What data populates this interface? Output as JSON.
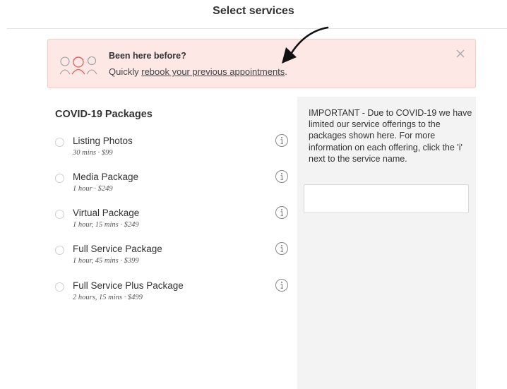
{
  "header": {
    "title": "Select services"
  },
  "banner": {
    "title": "Been here before?",
    "text_prefix": "Quickly ",
    "link_text": "rebook your previous appointments",
    "text_suffix": ".",
    "accent_color": "#e0605a",
    "background_color": "#fde8e6"
  },
  "services_section": {
    "title": "COVID-19 Packages",
    "items": [
      {
        "name": "Listing Photos",
        "meta": "30 mins · $99"
      },
      {
        "name": "Media Package",
        "meta": "1 hour · $249"
      },
      {
        "name": "Virtual Package",
        "meta": "1 hour, 15 mins · $249"
      },
      {
        "name": "Full Service Package",
        "meta": "1 hour, 45 mins · $399"
      },
      {
        "name": "Full Service Plus Package",
        "meta": "2 hours, 15 mins · $499"
      }
    ]
  },
  "side_panel": {
    "notice": "IMPORTANT - Due to COVID-19 we have limited our service offerings to the packages shown here. For more information on each offering, click the 'i' next to the service name.",
    "input_value": ""
  },
  "icons": [
    "people-illustration-icon",
    "arrow-icon",
    "close-icon",
    "info-icon",
    "radio-icon"
  ]
}
